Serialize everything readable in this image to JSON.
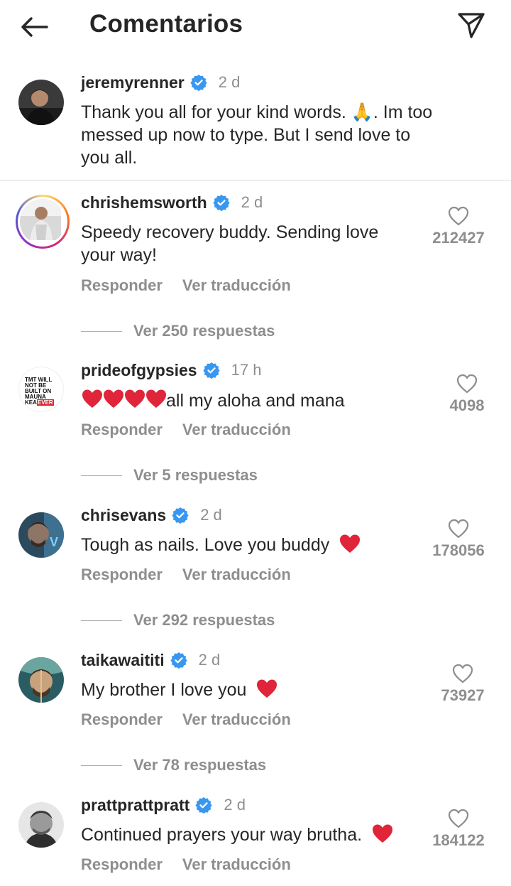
{
  "header": {
    "title": "Comentarios"
  },
  "caption": {
    "username": "jeremyrenner",
    "time": "2 d",
    "text_line1": "Thank you all for your kind words. 🙏. Im too",
    "text_line2": "messed up now to type.  But I send love to",
    "text_line3": "you all."
  },
  "comments": [
    {
      "username": "chrishemsworth",
      "time": "2 d",
      "text_line1": "Speedy recovery buddy. Sending love",
      "text_line2": "your way!",
      "likes": "212427",
      "reply_label": "Responder",
      "translate_label": "Ver traducción",
      "replies_label": "Ver 250 respuestas"
    },
    {
      "username": "prideofgypsies",
      "time": "17 h",
      "text": "all my aloha and mana",
      "likes": "4098",
      "reply_label": "Responder",
      "translate_label": "Ver traducción",
      "replies_label": "Ver 5 respuestas",
      "avatar_text_1": "TMT WILL",
      "avatar_text_2": "NOT BE",
      "avatar_text_3": "BUILT ON",
      "avatar_text_4": "MAUNA",
      "avatar_text_5": "KEA",
      "avatar_text_6": "EVER"
    },
    {
      "username": "chrisevans",
      "time": "2 d",
      "text": "Tough as nails. Love you buddy",
      "likes": "178056",
      "reply_label": "Responder",
      "translate_label": "Ver traducción",
      "replies_label": "Ver 292 respuestas"
    },
    {
      "username": "taikawaititi",
      "time": "2 d",
      "text": "My brother I love you",
      "likes": "73927",
      "reply_label": "Responder",
      "translate_label": "Ver traducción",
      "replies_label": "Ver 78 respuestas"
    },
    {
      "username": "prattprattpratt",
      "time": "2 d",
      "text": "Continued prayers your way brutha.",
      "likes": "184122",
      "reply_label": "Responder",
      "translate_label": "Ver traducción"
    }
  ],
  "icons": {
    "back": "arrow-left-icon",
    "share": "paper-plane-icon",
    "verified": "verified-badge-icon",
    "like": "heart-outline-icon"
  },
  "colors": {
    "verified": "#3897f0",
    "muted": "#8e8e8e",
    "text": "#262626",
    "emoji_heart": "#e0243a"
  }
}
